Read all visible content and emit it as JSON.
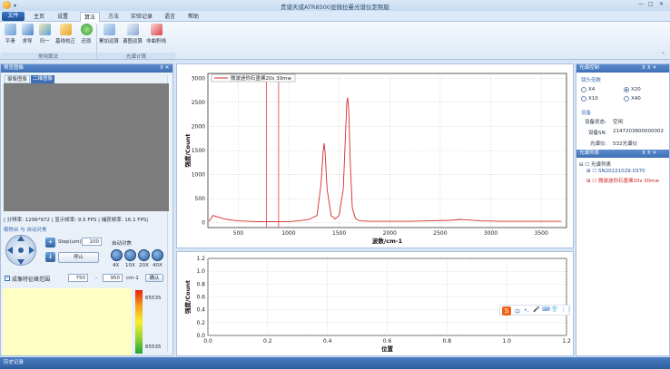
{
  "window": {
    "title": "贵谱天成ATR8500显微拉曼光谱仪定制版",
    "controls": [
      "—",
      "□",
      "✕"
    ]
  },
  "menu": {
    "app_button": "文件",
    "tabs": [
      "主页",
      "设置",
      "算法",
      "方法",
      "实验记录",
      "语言",
      "帮助"
    ],
    "active_tab": "算法"
  },
  "ribbon": {
    "buttons": [
      "平滑",
      "求导",
      "归一",
      "基线校正",
      "还原",
      "累加运算",
      "谱图运算",
      "非曲积线"
    ],
    "groups": [
      "常用算法",
      "光谱计算"
    ]
  },
  "left_panel": {
    "title": "预览图像",
    "tabs": [
      "摄像图像",
      "二维图像"
    ],
    "status": "| 分辨率: 1296*972 | 显示帧率: 9.5 FPS | 捕获帧率: 16.1 FPS|",
    "stage_title": "载物台 与 自动对焦",
    "step_label": "Step(um):",
    "step_value": "100",
    "autofocus_label": "自动对焦",
    "stop_button": "停止",
    "objectives": [
      "4X",
      "10X",
      "20X",
      "40X"
    ],
    "range_checkbox": "成像特征峰范围",
    "range_from": "750",
    "range_sep": "-",
    "range_to": "950",
    "range_unit": "cm-1",
    "confirm_button": "确认",
    "colorbar_max": "65535",
    "colorbar_min": "65535"
  },
  "chart_main": {
    "legend": "微波迷你石墨烯20s 30mw",
    "xlabel": "波数/cm-1",
    "ylabel": "强度/Count",
    "xticks": [
      "500",
      "1000",
      "1500",
      "2000",
      "2500",
      "3000",
      "3500"
    ],
    "yticks": [
      "0",
      "500",
      "1000",
      "1500",
      "2000",
      "2500",
      "3000"
    ]
  },
  "chart_sub": {
    "xlabel": "位置",
    "ylabel": "强度/Count",
    "xticks": [
      "0.0",
      "0.2",
      "0.4",
      "0.6",
      "0.8",
      "1.0",
      "1.2"
    ],
    "yticks": [
      "0.0",
      "0.2",
      "0.4",
      "0.6",
      "0.8",
      "1.0",
      "1.2"
    ]
  },
  "chart_data": [
    {
      "type": "line",
      "series": [
        {
          "name": "微波迷你石墨烯20s 30mw",
          "x": [
            210,
            250,
            300,
            360,
            420,
            500,
            600,
            700,
            800,
            900,
            1000,
            1100,
            1200,
            1280,
            1320,
            1340,
            1350,
            1360,
            1380,
            1420,
            1460,
            1500,
            1540,
            1560,
            1575,
            1585,
            1595,
            1610,
            1630,
            1660,
            1700,
            1800,
            2000,
            2200,
            2400,
            2600,
            2700,
            2900,
            3100,
            3300,
            3500,
            3700
          ],
          "y": [
            30,
            150,
            120,
            80,
            60,
            40,
            30,
            25,
            20,
            20,
            25,
            40,
            70,
            150,
            800,
            1450,
            1650,
            1450,
            700,
            150,
            80,
            150,
            700,
            1700,
            2500,
            2600,
            2300,
            1200,
            300,
            90,
            40,
            30,
            30,
            30,
            40,
            50,
            70,
            40,
            30,
            30,
            30,
            30
          ]
        }
      ],
      "xlabel": "波数/cm-1",
      "ylabel": "强度/Count",
      "xlim": [
        200,
        3750
      ],
      "ylim": [
        -100,
        3100
      ],
      "markers_x": [
        780,
        900
      ],
      "grid": true,
      "legend": "top-left"
    },
    {
      "type": "line",
      "series": [],
      "xlabel": "位置",
      "ylabel": "强度/Count",
      "xlim": [
        0,
        1.2
      ],
      "ylim": [
        0,
        1.2
      ],
      "grid": true
    }
  ],
  "right_panel": {
    "title": "光谱控制",
    "magnification_title": "镜头倍数",
    "magnifications": [
      "X4",
      "X20",
      "X10",
      "X40"
    ],
    "selected_magnification": "X20",
    "device_title": "设备",
    "device_status_label": "设备状态:",
    "device_status": "空闲",
    "device_sn_label": "设备SN:",
    "device_sn": "2147203800000002",
    "spectrometer_label": "光谱仪:",
    "spectrometer": "532光谱仪",
    "list_title": "光谱列表",
    "list_root": "光谱列表",
    "list_items": [
      "SN20221029-0370",
      "微波迷你石墨烯20s 30mw"
    ]
  },
  "bottom": {
    "title": "历史记录"
  },
  "ime": {
    "labels": [
      "中",
      "•,",
      "🎤",
      "⌨",
      "👕",
      "⋮⋮"
    ]
  }
}
